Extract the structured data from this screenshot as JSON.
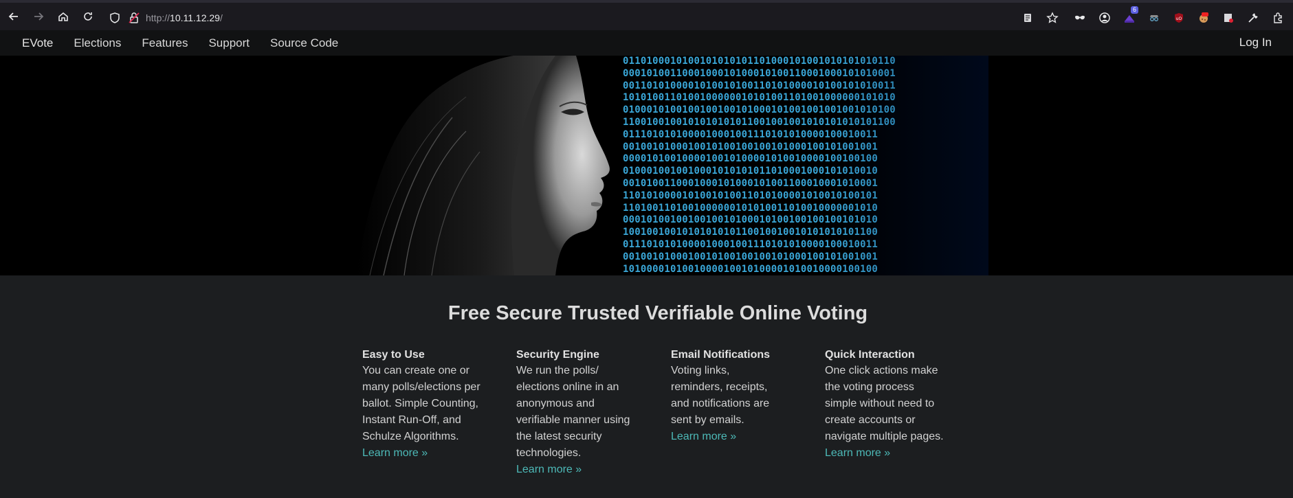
{
  "browser": {
    "url_prefix": "http://",
    "url_host": "10.11.12.29",
    "url_suffix": "/",
    "extension_badge": "6"
  },
  "nav": {
    "brand": "EVote",
    "links": [
      "Elections",
      "Features",
      "Support",
      "Source Code"
    ],
    "login": "Log In"
  },
  "hero": {
    "binary_rows": [
      "0110100010100101010101101000101001010101010110",
      "0001010011000100010100010100110001000101010001",
      "0011010100001010010100110101000010100101010011",
      "1010100110100100000010101001101001000000101010",
      "0100010100100100100101000101001001001001010100",
      "1100100100101010101011001001001010101010101100",
      "0111010101000010001001110101010000100010011",
      "0010010100010010100100100101000100101001001",
      "0000101001000010010100001010010000100100100",
      "0100010010010001010101011010001000101010010",
      "0010100110001000101000101001100010001010001",
      "1101010000101001010011010100001010010100101",
      "1101001101001000000101010011010010000001010",
      "0001010010010010010100010100100100100101010",
      "1001001001010101010110010010010101010101100",
      "0111010101000010001001110101010000100010011",
      "0010010100010010100100100101000100101001001",
      "1010000101001000010010100001010010000100100"
    ]
  },
  "content": {
    "headline": "Free Secure Trusted Verifiable Online Voting",
    "features": [
      {
        "title": "Easy to Use",
        "text": "You can create one or many polls/elections per ballot. Simple Counting, Instant Run-Off, and Schulze Algorithms.",
        "link": "Learn more »"
      },
      {
        "title": "Security Engine",
        "text": "We run the polls/ elections online in an anonymous and verifiable manner using the latest security technologies.",
        "link": "Learn more »"
      },
      {
        "title": "Email Notifications",
        "text": "Voting links, reminders, receipts, and notifications are sent by emails.",
        "link": "Learn more »"
      },
      {
        "title": "Quick Interaction",
        "text": "One click actions make the voting process simple without need to create accounts or navigate multiple pages.",
        "link": "Learn more »"
      }
    ]
  },
  "colors": {
    "accent_link": "#4dbab8",
    "binary": "#3aa7d8",
    "nav_bg": "#111213",
    "page_bg": "#1c1e20"
  },
  "icons": [
    "back-icon",
    "forward-icon",
    "home-icon",
    "reload-icon",
    "shield-icon",
    "insecure-lock-icon",
    "reader-view-icon",
    "bookmark-star-icon",
    "mask-extension-icon",
    "account-icon",
    "hat-extension-icon",
    "spy-extension-icon",
    "ublock-icon",
    "cookie-extension-icon",
    "page-extension-icon",
    "tools-icon",
    "extensions-icon"
  ]
}
